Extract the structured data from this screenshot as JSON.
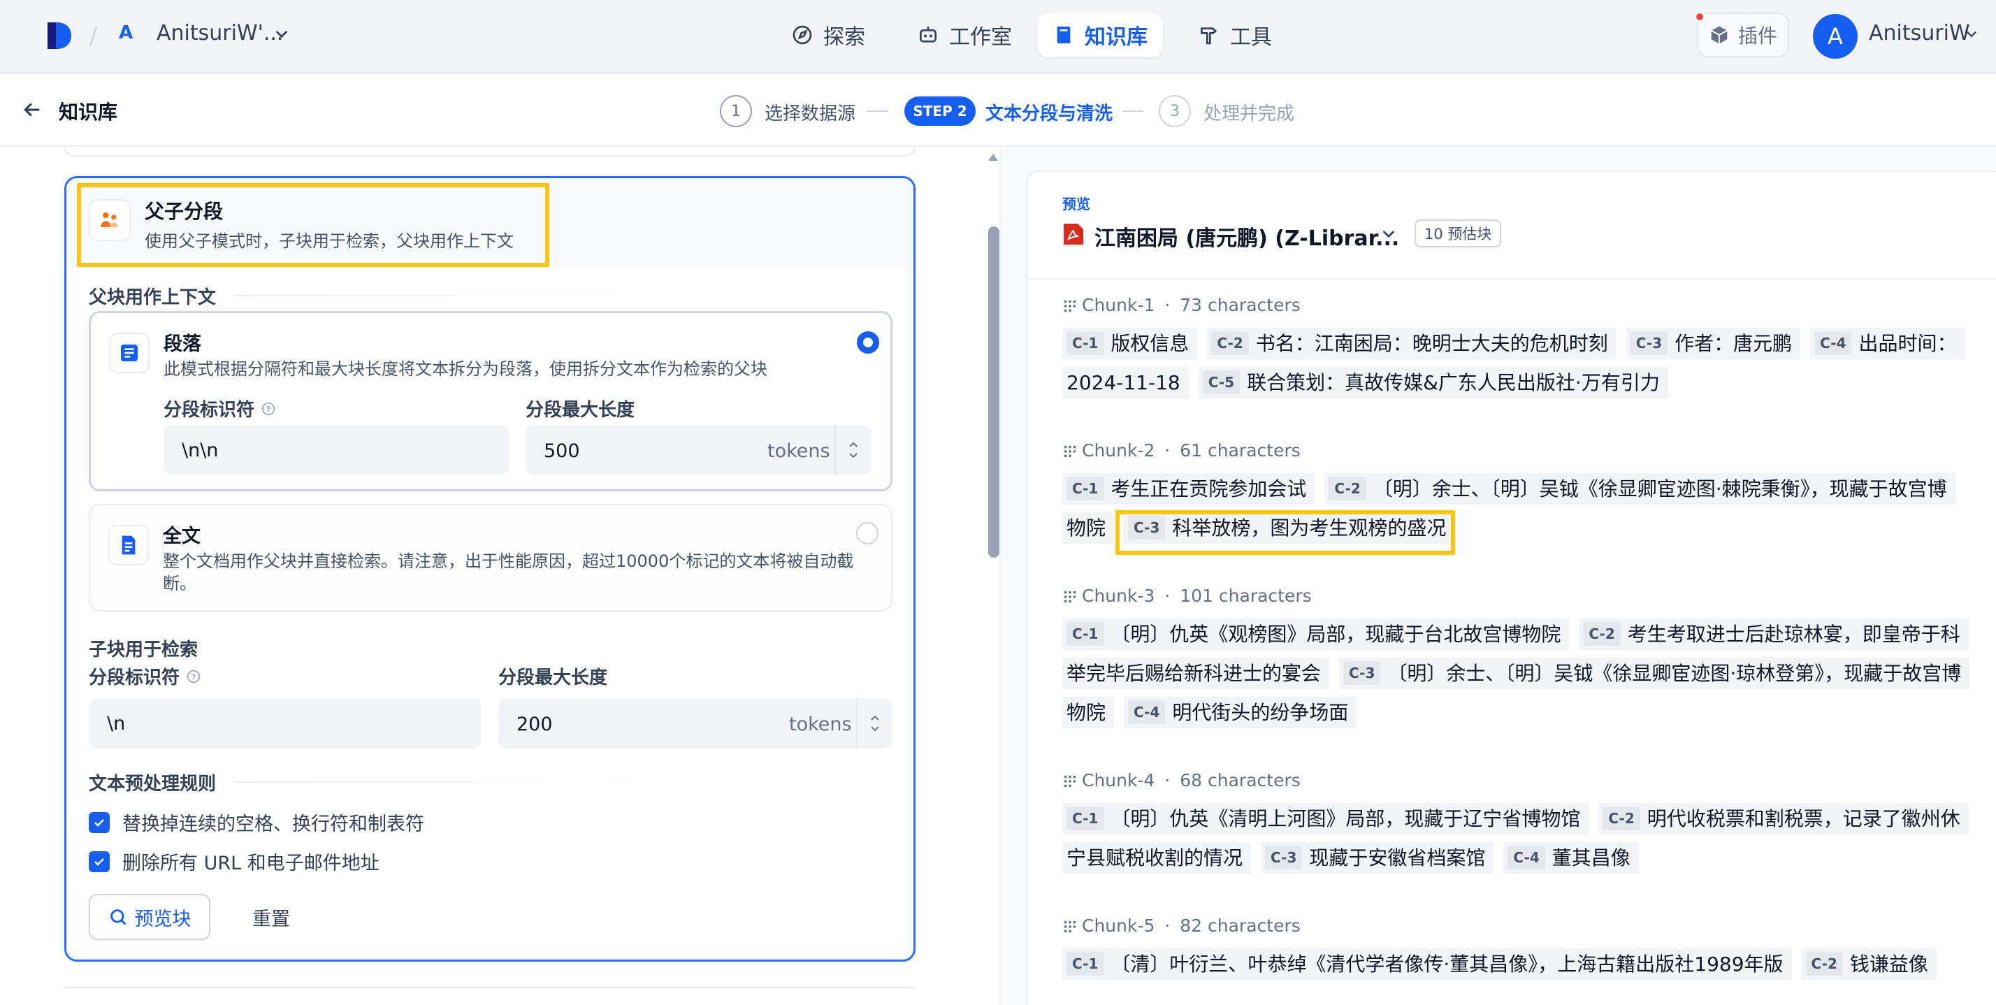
{
  "topbar": {
    "workspace": {
      "avatar": "A",
      "name": "AnitsuriW'..."
    },
    "nav": [
      {
        "label": "探索",
        "icon": "compass-icon"
      },
      {
        "label": "工作室",
        "icon": "robot-icon"
      },
      {
        "label": "知识库",
        "icon": "book-icon",
        "active": true
      },
      {
        "label": "工具",
        "icon": "hammer-icon"
      }
    ],
    "plugin_label": "插件",
    "user": {
      "avatar": "A",
      "name": "AnitsuriW"
    }
  },
  "subheader": {
    "back_label": "知识库",
    "steps": [
      {
        "num": "1",
        "label": "选择数据源",
        "state": "done"
      },
      {
        "num": "STEP 2",
        "label": "文本分段与清洗",
        "state": "active"
      },
      {
        "num": "3",
        "label": "处理并完成",
        "state": "pending"
      }
    ]
  },
  "config": {
    "mode": {
      "title": "父子分段",
      "desc": "使用父子模式时，子块用于检索，父块用作上下文"
    },
    "parent": {
      "section_label": "父块用作上下文",
      "paragraph": {
        "title": "段落",
        "desc": "此模式根据分隔符和最大块长度将文本拆分为段落，使用拆分文本作为检索的父块",
        "selected": true,
        "separator_label": "分段标识符",
        "separator_value": "\\n\\n",
        "maxlen_label": "分段最大长度",
        "maxlen_value": "500",
        "maxlen_unit": "tokens"
      },
      "fulltext": {
        "title": "全文",
        "desc_line1": "整个文档用作父块并直接检索。请注意，出于性能原因，超过10000个标记的文本将被自动截",
        "desc_line2": "断。",
        "selected": false
      }
    },
    "child": {
      "section_label": "子块用于检索",
      "separator_label": "分段标识符",
      "separator_value": "\\n",
      "maxlen_label": "分段最大长度",
      "maxlen_value": "200",
      "maxlen_unit": "tokens"
    },
    "rules": {
      "section_label": "文本预处理规则",
      "items": [
        {
          "label": "替换掉连续的空格、换行符和制表符",
          "checked": true
        },
        {
          "label": "删除所有 URL 和电子邮件地址",
          "checked": true
        }
      ]
    },
    "preview_button": "预览块",
    "reset_button": "重置"
  },
  "preview": {
    "label": "预览",
    "file_name": "江南困局 (唐元鹏) (Z-Librar...",
    "badge": "10 预估块",
    "chunks": [
      {
        "header": "Chunk-1",
        "chars": "73 characters",
        "segments": [
          {
            "tag": "C-1",
            "text": "版权信息"
          },
          {
            "tag": "C-2",
            "text": "书名：江南困局：晚明士大夫的危机时刻"
          },
          {
            "tag": "C-3",
            "text": "作者：唐元鹏"
          },
          {
            "tag": "C-4",
            "text": "出品时间：2024-11-18"
          },
          {
            "tag": "C-5",
            "text": "联合策划：真故传媒&广东人民出版社·万有引力"
          }
        ]
      },
      {
        "header": "Chunk-2",
        "chars": "61 characters",
        "segments": [
          {
            "tag": "C-1",
            "text": "考生正在贡院参加会试"
          },
          {
            "tag": "C-2",
            "text": "〔明〕余士、〔明〕吴钺《徐显卿宦迹图·棘院秉衡》，现藏于故宫博物院"
          },
          {
            "tag": "C-3",
            "text": "科举放榜，图为考生观榜的盛况",
            "highlight": true
          }
        ]
      },
      {
        "header": "Chunk-3",
        "chars": "101 characters",
        "segments": [
          {
            "tag": "C-1",
            "text": "〔明〕仇英《观榜图》局部，现藏于台北故宫博物院"
          },
          {
            "tag": "C-2",
            "text": "考生考取进士后赴琼林宴，即皇帝于科举完毕后赐给新科进士的宴会"
          },
          {
            "tag": "C-3",
            "text": "〔明〕余士、〔明〕吴钺《徐显卿宦迹图·琼林登第》，现藏于故宫博物院"
          },
          {
            "tag": "C-4",
            "text": "明代街头的纷争场面"
          }
        ]
      },
      {
        "header": "Chunk-4",
        "chars": "68 characters",
        "segments": [
          {
            "tag": "C-1",
            "text": "〔明〕仇英《清明上河图》局部，现藏于辽宁省博物馆"
          },
          {
            "tag": "C-2",
            "text": "明代收税票和割税票，记录了徽州休宁县赋税收割的情况"
          },
          {
            "tag": "C-3",
            "text": "现藏于安徽省档案馆"
          },
          {
            "tag": "C-4",
            "text": "董其昌像"
          }
        ]
      },
      {
        "header": "Chunk-5",
        "chars": "82 characters",
        "segments": [
          {
            "tag": "C-1",
            "text": "〔清〕叶衍兰、叶恭绰《清代学者像传·董其昌像》，上海古籍出版社1989年版"
          },
          {
            "tag": "C-2",
            "text": "钱谦益像"
          }
        ]
      }
    ]
  },
  "colors": {
    "accent": "#155eef",
    "highlight": "#fac415",
    "selected_border": "#296dff"
  }
}
